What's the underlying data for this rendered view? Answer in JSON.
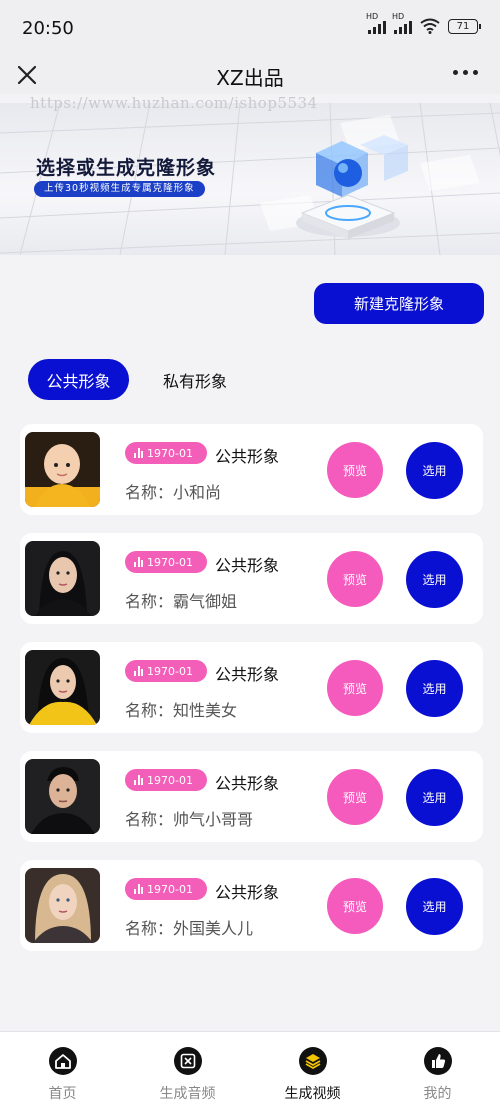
{
  "status": {
    "time": "20:50",
    "battery": "71",
    "network_label": "HD"
  },
  "nav": {
    "title": "XZ出品",
    "close_icon": "close-icon",
    "more_icon": "more-icon"
  },
  "watermark": "https://www.huzhan.com/ishop5534",
  "banner": {
    "title": "选择或生成克隆形象",
    "subtitle": "上传30秒视频生成专属克隆形象"
  },
  "new_button": "新建克隆形象",
  "tabs": {
    "public": "公共形象",
    "private": "私有形象",
    "active": "public"
  },
  "avatars": [
    {
      "date": "1970-01",
      "type": "公共形象",
      "name_prefix": "名称：",
      "name": "小和尚",
      "preview": "预览",
      "select": "选用"
    },
    {
      "date": "1970-01",
      "type": "公共形象",
      "name_prefix": "名称：",
      "name": "霸气御姐",
      "preview": "预览",
      "select": "选用"
    },
    {
      "date": "1970-01",
      "type": "公共形象",
      "name_prefix": "名称：",
      "name": "知性美女",
      "preview": "预览",
      "select": "选用"
    },
    {
      "date": "1970-01",
      "type": "公共形象",
      "name_prefix": "名称：",
      "name": "帅气小哥哥",
      "preview": "预览",
      "select": "选用"
    },
    {
      "date": "1970-01",
      "type": "公共形象",
      "name_prefix": "名称：",
      "name": "外国美人儿",
      "preview": "预览",
      "select": "选用"
    }
  ],
  "tabbar": [
    {
      "label": "首页",
      "icon": "home-icon",
      "active": false
    },
    {
      "label": "生成音频",
      "icon": "audio-icon",
      "active": false
    },
    {
      "label": "生成视频",
      "icon": "video-layers-icon",
      "active": true
    },
    {
      "label": "我的",
      "icon": "thumbs-up-icon",
      "active": false
    }
  ],
  "colors": {
    "primary": "#0a10d1",
    "pink": "#f45bbd",
    "background": "#f3f3f6"
  }
}
